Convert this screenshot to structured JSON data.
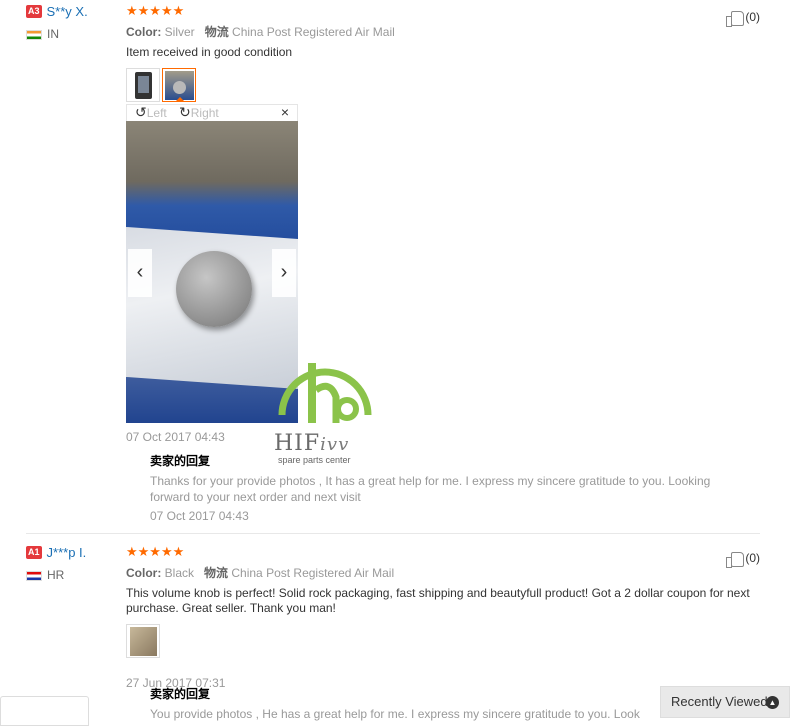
{
  "reviews": [
    {
      "level": "A3",
      "username": "S**y X.",
      "country": "IN",
      "stars": "★★★★★",
      "color_label": "Color:",
      "color_value": "Silver",
      "shipping_label": "物流",
      "shipping_value": "China Post Registered Air Mail",
      "text": "Item received in good condition",
      "date": "07 Oct 2017 04:43",
      "helpful_count": "(0)",
      "reply_title": "卖家的回复",
      "reply_text": "Thanks for your provide photos , It has a great help for me. I express my sincere gratitude to you. Looking forward to your next order and next visit",
      "reply_date": "07 Oct 2017 04:43"
    },
    {
      "level": "A1",
      "username": "J***p I.",
      "country": "HR",
      "stars": "★★★★★",
      "color_label": "Color:",
      "color_value": "Black",
      "shipping_label": "物流",
      "shipping_value": "China Post Registered Air Mail",
      "text": "This volume knob is perfect! Solid rock packaging, fast shipping and beautyfull product! Got a 2 dollar coupon for next purchase. Great seller. Thank you man!",
      "date": "27 Jun 2017 07:31",
      "helpful_count": "(0)",
      "reply_title": "卖家的回复",
      "reply_text": "You provide photos , He has a great help for me. I express my sincere gratitude to you. Look"
    }
  ],
  "viewer": {
    "rotate_left": "Left",
    "rotate_right": "Right",
    "close": "×",
    "prev": "‹",
    "next": "›"
  },
  "watermark": {
    "brand": "HIF",
    "brand_tail": "ivv",
    "tagline": "spare parts center"
  },
  "recently_viewed": {
    "label": "Recently Viewed",
    "icon": "chevron-up-icon"
  },
  "colors": {
    "stars": "#ff6a00",
    "username": "#1a6fb4",
    "badge": "#e4393c",
    "logo_green": "#8bc34a"
  }
}
